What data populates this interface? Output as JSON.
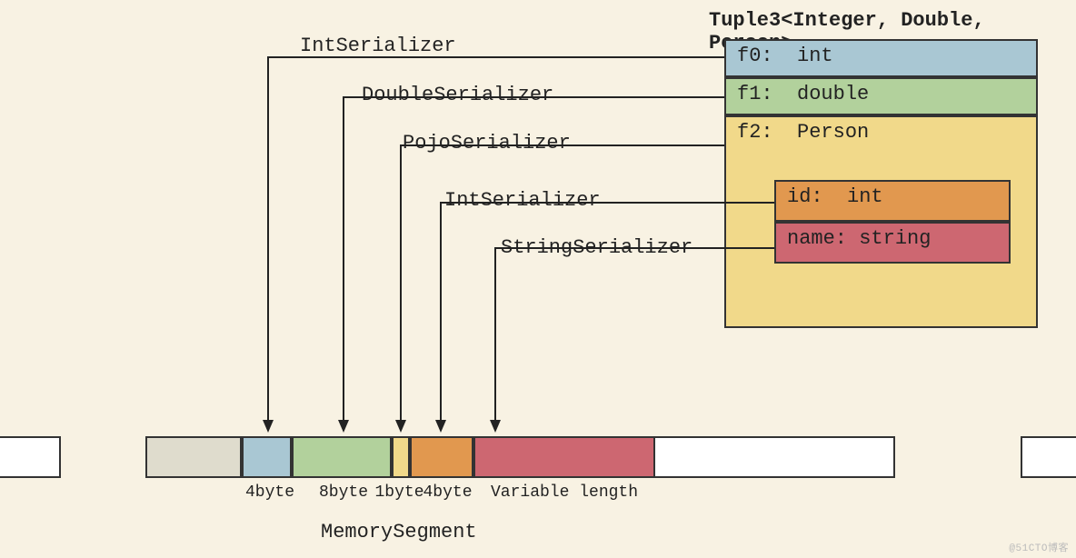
{
  "title": "Tuple3<Integer, Double, Person>",
  "serializers": {
    "s0": "IntSerializer",
    "s1": "DoubleSerializer",
    "s2": "PojoSerializer",
    "s3": "IntSerializer",
    "s4": "StringSerializer"
  },
  "tuple_fields": {
    "f0": "f0:  int",
    "f1": "f1:  double",
    "f2": "f2:  Person",
    "id": "id:  int",
    "name": "name: string"
  },
  "segment_sizes": {
    "b0": "4byte",
    "b1": "8byte",
    "b2": "1byte",
    "b3": "4byte",
    "b4": "Variable length"
  },
  "memory_label": "MemorySegment",
  "watermark": "@51CTO博客",
  "colors": {
    "int": "#a9c7d3",
    "double": "#b2d19c",
    "pojo": "#f1d98a",
    "id": "#e1984f",
    "name": "#cd6771",
    "gray": "#dfdccd",
    "white": "#ffffff"
  },
  "chart_data": {
    "type": "diagram",
    "object_type": "Tuple3<Integer, Double, Person>",
    "fields": [
      {
        "name": "f0",
        "type": "int",
        "serializer": "IntSerializer",
        "bytes": 4
      },
      {
        "name": "f1",
        "type": "double",
        "serializer": "DoubleSerializer",
        "bytes": 8
      },
      {
        "name": "f2",
        "type": "Person",
        "serializer": "PojoSerializer",
        "bytes": 1,
        "children": [
          {
            "name": "id",
            "type": "int",
            "serializer": "IntSerializer",
            "bytes": 4
          },
          {
            "name": "name",
            "type": "string",
            "serializer": "StringSerializer",
            "bytes": "variable"
          }
        ]
      }
    ],
    "memory_layout": [
      {
        "label": "4byte",
        "field": "f0"
      },
      {
        "label": "8byte",
        "field": "f1"
      },
      {
        "label": "1byte",
        "field": "f2-header"
      },
      {
        "label": "4byte",
        "field": "f2.id"
      },
      {
        "label": "Variable length",
        "field": "f2.name"
      }
    ],
    "container_label": "MemorySegment"
  }
}
